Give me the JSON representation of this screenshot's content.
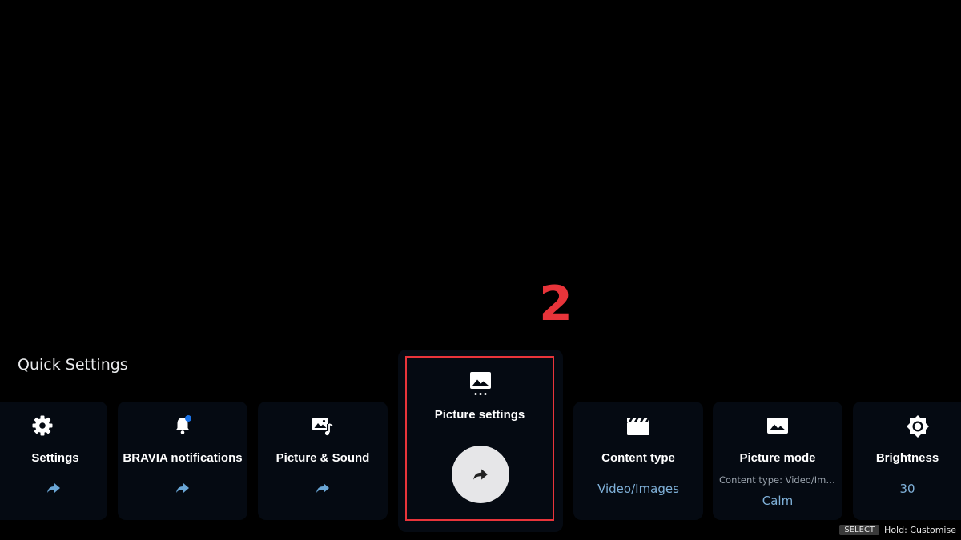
{
  "annotation": {
    "number": "2"
  },
  "section_title": "Quick Settings",
  "tiles": [
    {
      "label": "Settings",
      "icon": "gear-icon"
    },
    {
      "label": "BRAVIA notifications",
      "icon": "bell-icon"
    },
    {
      "label": "Picture & Sound",
      "icon": "picture-sound-icon"
    },
    {
      "label": "Picture settings",
      "icon": "picture-settings-icon"
    },
    {
      "label": "Content type",
      "value": "Video/Images",
      "icon": "clapperboard-icon"
    },
    {
      "label": "Picture mode",
      "sub": "Content type: Video/Ima...",
      "value": "Calm",
      "icon": "picture-icon"
    },
    {
      "label": "Brightness",
      "value": "30",
      "icon": "brightness-icon"
    }
  ],
  "hint": {
    "key": "SELECT",
    "text": "Hold: Customise"
  },
  "colors": {
    "accent_arrow": "#6aa6d6",
    "value_text": "#7fb0d8",
    "highlight": "#e8343a",
    "notification_dot": "#1a73e8"
  }
}
